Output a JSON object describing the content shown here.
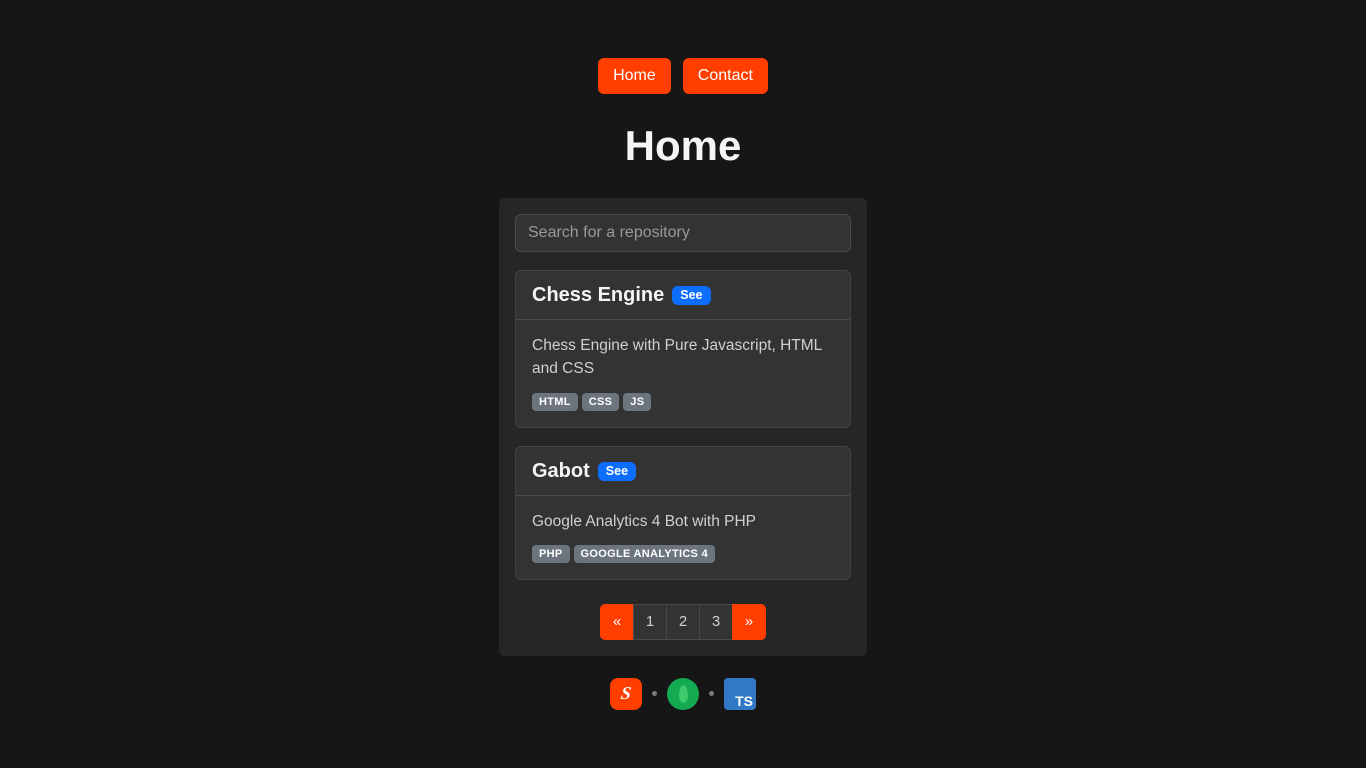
{
  "nav": {
    "home": "Home",
    "contact": "Contact"
  },
  "title": "Home",
  "search": {
    "placeholder": "Search for a repository"
  },
  "repos": [
    {
      "name": "Chess Engine",
      "see": "See",
      "desc": "Chess Engine with Pure Javascript, HTML and CSS",
      "tags": [
        "HTML",
        "CSS",
        "JS"
      ]
    },
    {
      "name": "Gabot",
      "see": "See",
      "desc": "Google Analytics 4 Bot with PHP",
      "tags": [
        "PHP",
        "GOOGLE ANALYTICS 4"
      ]
    }
  ],
  "pagination": {
    "prev": "«",
    "pages": [
      "1",
      "2",
      "3"
    ],
    "next": "»"
  },
  "footer": {
    "svelte": "S",
    "ts": "TS"
  }
}
